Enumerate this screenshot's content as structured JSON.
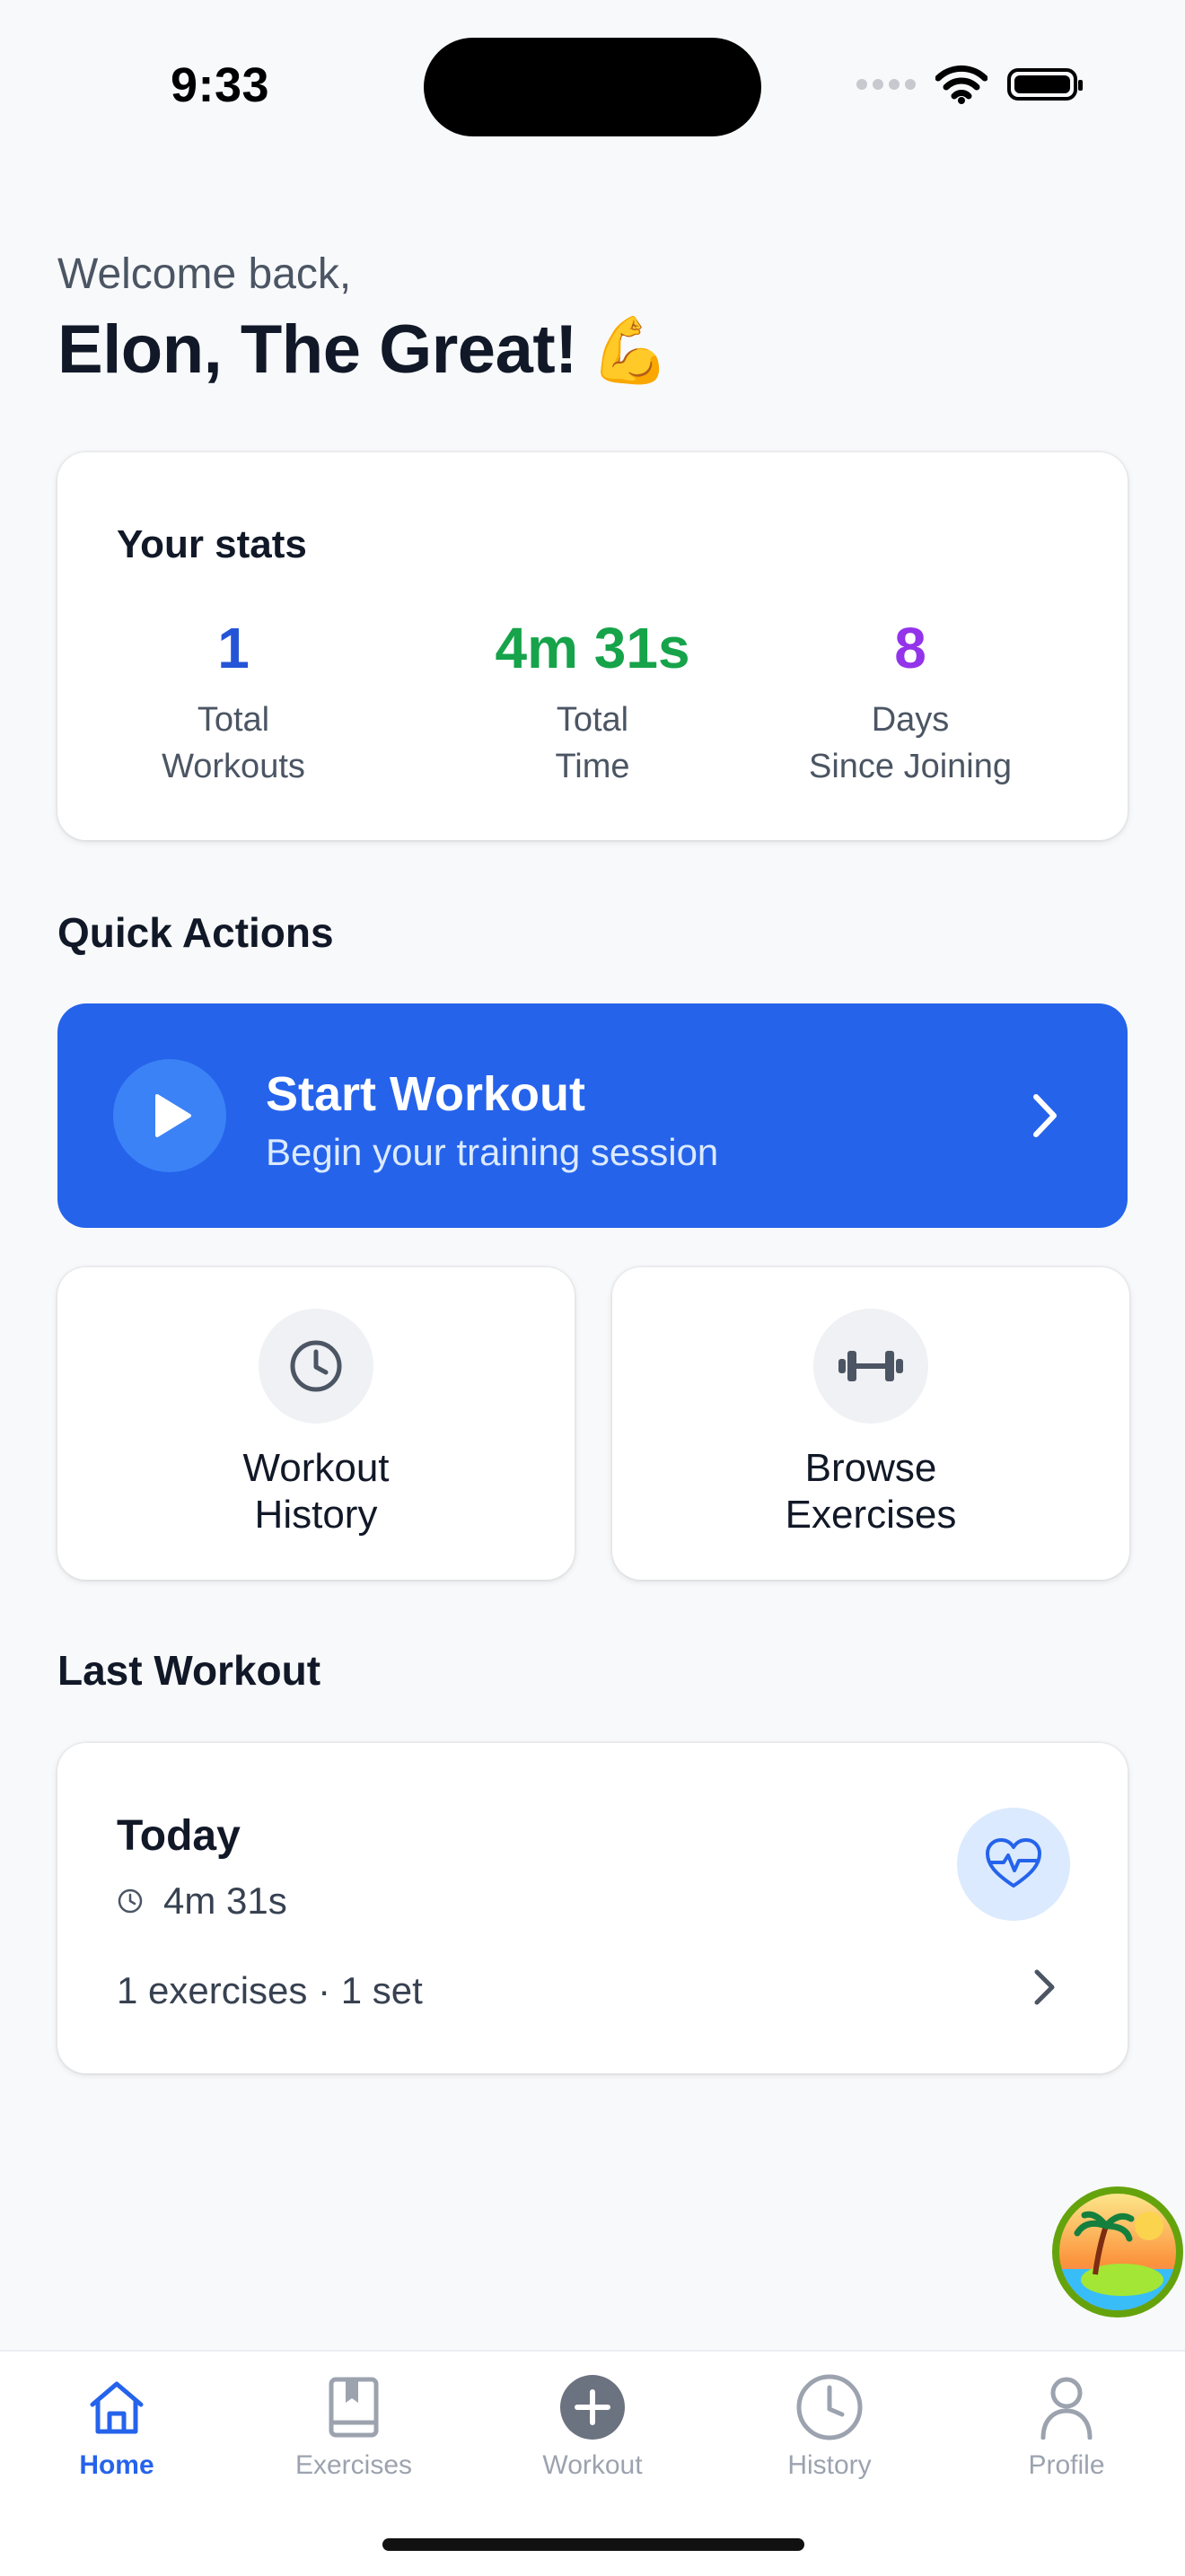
{
  "status_bar": {
    "time": "9:33"
  },
  "header": {
    "welcome": "Welcome back,",
    "username": "Elon, The Great!",
    "emoji": "💪"
  },
  "stats": {
    "title": "Your stats",
    "items": [
      {
        "value": "1",
        "label_line1": "Total",
        "label_line2": "Workouts",
        "color": "#2455d6"
      },
      {
        "value": "4m 31s",
        "label_line1": "Total",
        "label_line2": "Time",
        "color": "#16a34a"
      },
      {
        "value": "8",
        "label_line1": "Days",
        "label_line2": "Since Joining",
        "color": "#9333ea"
      }
    ]
  },
  "quick_actions": {
    "title": "Quick Actions",
    "start_workout": {
      "title": "Start Workout",
      "subtitle": "Begin your training session",
      "icon": "play-icon"
    },
    "history": {
      "line1": "Workout",
      "line2": "History",
      "icon": "clock-icon"
    },
    "browse": {
      "line1": "Browse",
      "line2": "Exercises",
      "icon": "dumbbell-icon"
    }
  },
  "last_workout": {
    "title": "Last Workout",
    "day": "Today",
    "duration": "4m 31s",
    "meta": "1 exercises · 1 set",
    "icon": "heart-pulse-icon"
  },
  "tabbar": {
    "tabs": [
      {
        "label": "Home",
        "icon": "home-icon",
        "active": true
      },
      {
        "label": "Exercises",
        "icon": "book-icon",
        "active": false
      },
      {
        "label": "Workout",
        "icon": "plus-circle-icon",
        "active": false
      },
      {
        "label": "History",
        "icon": "clock-icon",
        "active": false
      },
      {
        "label": "Profile",
        "icon": "person-icon",
        "active": false
      }
    ]
  },
  "colors": {
    "accent": "#2563eb",
    "background": "#f8f9fb",
    "inactive_tab": "#9ca3af"
  }
}
